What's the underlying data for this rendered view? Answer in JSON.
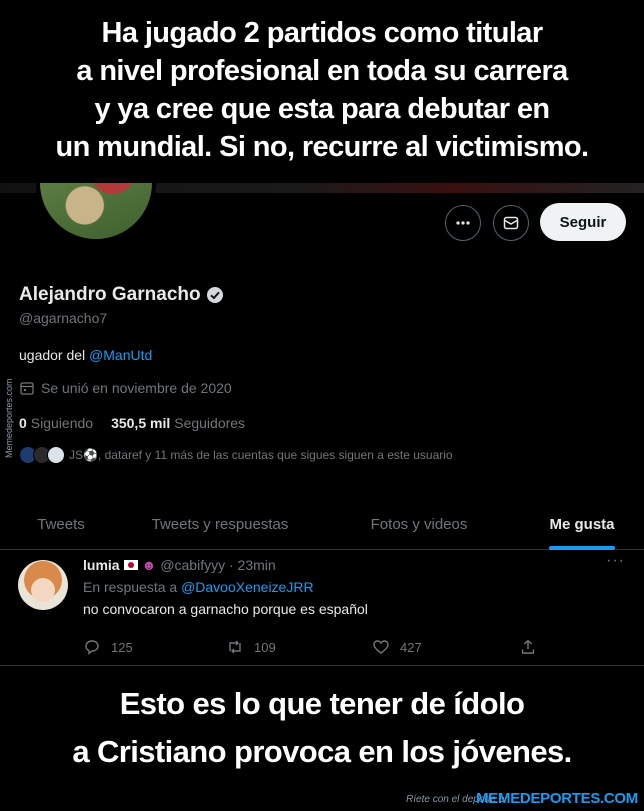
{
  "captions": {
    "top": [
      "Ha jugado 2 partidos como titular",
      "a nivel profesional en toda su carrera",
      "y ya cree que esta para debutar en",
      "un mundial. Si no, recurre al victimismo."
    ],
    "bottom": [
      "Esto es lo que tener de ídolo",
      "a Cristiano provoca en los jóvenes."
    ]
  },
  "profile": {
    "follow_label": "Seguir",
    "name": "Alejandro Garnacho",
    "handle": "@agarnacho7",
    "bio_prefix": "ugador del ",
    "bio_link": "@ManUtd",
    "joined": "Se unió en noviembre de 2020",
    "following_count": "0",
    "following_label": "Siguiendo",
    "followers_count": "350,5 mil",
    "followers_label": "Seguidores",
    "followers_known": "JS⚽, dataref y 11 más de las cuentas que sigues siguen a este usuario",
    "side_watermark": "Memedeportes.com"
  },
  "tabs": [
    {
      "label": "Tweets",
      "active": false
    },
    {
      "label": "Tweets y respuestas",
      "active": false
    },
    {
      "label": "Fotos y videos",
      "active": false
    },
    {
      "label": "Me gusta",
      "active": true
    }
  ],
  "tweet": {
    "name": "lumia",
    "handle_time": "@cabifyyy · 23min",
    "reply_prefix": "En respuesta a ",
    "reply_to": "@DavooXeneizeJRR",
    "text": "no convocaron a garnacho porque es español",
    "replies": "125",
    "retweets": "109",
    "likes": "427"
  },
  "footer": {
    "text": "Ríete con el deporte en",
    "brand": "MEMEDEPORTES.COM"
  },
  "colors": {
    "accent": "#1d9bf0",
    "background": "#000000",
    "muted": "#71767b"
  }
}
